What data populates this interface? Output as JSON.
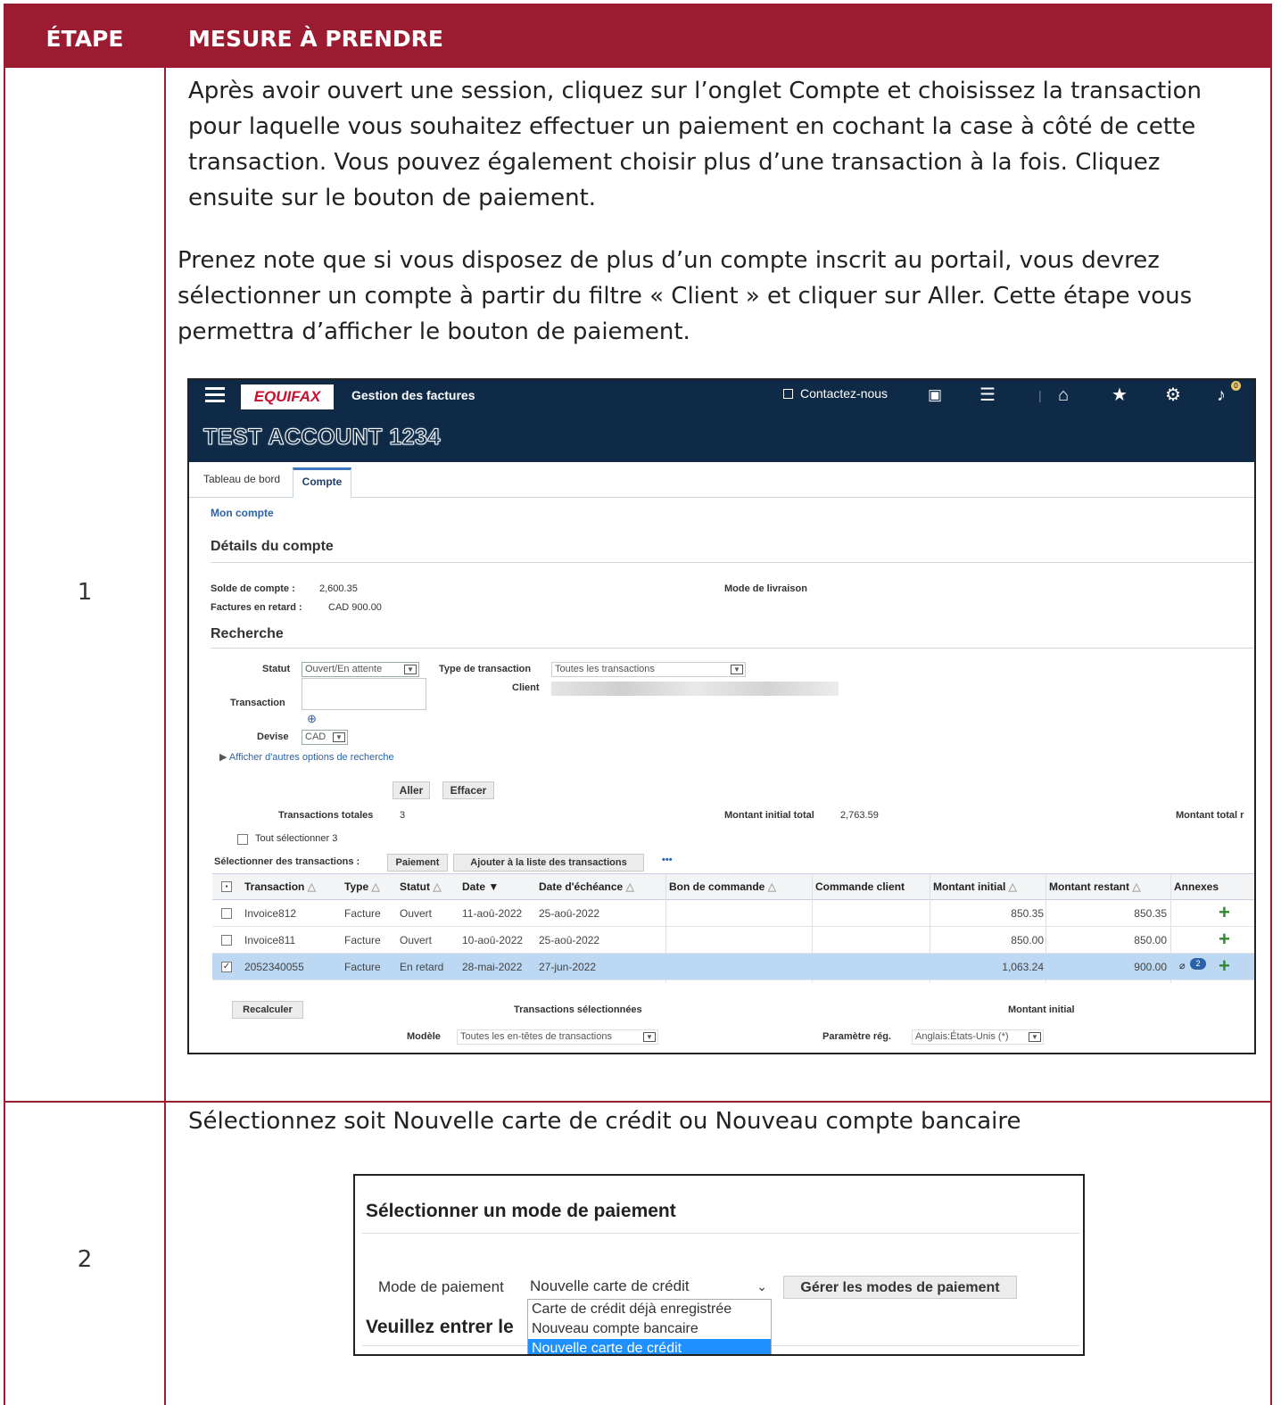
{
  "header": {
    "col_step": "ÉTAPE",
    "col_action": "MESURE À PRENDRE"
  },
  "steps": [
    {
      "number": "1",
      "paragraphs": [
        [
          "Après avoir ouvert une session, cliquez sur l’onglet Compte et choisissez la transaction",
          "pour laquelle vous souhaitez effectuer un paiement en cochant la case à côté de cette",
          "transaction. Vous pouvez également choisir plus d’une transaction à la fois. Cliquez",
          "ensuite sur le bouton de paiement."
        ],
        [
          "Prenez note que si vous disposez de plus d’un compte inscrit au portail, vous devrez",
          "sélectionner un compte à partir du filtre « Client » et cliquer sur Aller. Cette étape vous",
          "permettra d’afficher le bouton de paiement."
        ]
      ]
    },
    {
      "number": "2",
      "paragraphs": [
        [
          "Sélectionnez soit Nouvelle carte de crédit ou Nouveau compte bancaire"
        ]
      ]
    }
  ],
  "screenshot1": {
    "logo": "EQUIFAX",
    "app_title": "Gestion des factures",
    "contact": "Contactez-nous",
    "notification_count": "0",
    "account_name": "TEST ACCOUNT 1234",
    "tabs": [
      "Tableau de bord",
      "Compte"
    ],
    "breadcrumb": "Mon compte",
    "details_title": "Détails du compte",
    "balance_label": "Solde de compte :",
    "balance_value": "2,600.35",
    "overdue_label": "Factures en retard :",
    "overdue_value": "CAD 900.00",
    "delivery_label": "Mode de livraison",
    "search_title": "Recherche",
    "status_label": "Statut",
    "status_value": "Ouvert/En attente",
    "txn_type_label": "Type de transaction",
    "txn_type_value": "Toutes les transactions",
    "client_label": "Client",
    "transaction_label": "Transaction",
    "currency_label": "Devise",
    "currency_value": "CAD",
    "more_options": "Afficher d'autres options de recherche",
    "go_button": "Aller",
    "clear_button": "Effacer",
    "total_txn_label": "Transactions totales",
    "total_txn_value": "3",
    "initial_total_label": "Montant initial total",
    "initial_total_value": "2,763.59",
    "remaining_total_label": "Montant total r",
    "select_all": "Tout sélectionner 3",
    "select_txn_label": "Sélectionner des transactions :",
    "pay_button": "Paiement",
    "add_list_button": "Ajouter à la liste des transactions",
    "more": "•••",
    "columns": [
      "Transaction",
      "Type",
      "Statut",
      "Date",
      "Date d'échéance",
      "Bon de commande",
      "Commande client",
      "Montant initial",
      "Montant restant",
      "Annexes"
    ],
    "rows": [
      {
        "transaction": "Invoice812",
        "type": "Facture",
        "status": "Ouvert",
        "date": "11-aoû-2022",
        "due": "25-aoû-2022",
        "initial": "850.35",
        "remaining": "850.35",
        "checked": false,
        "attachments": ""
      },
      {
        "transaction": "Invoice811",
        "type": "Facture",
        "status": "Ouvert",
        "date": "10-aoû-2022",
        "due": "25-aoû-2022",
        "initial": "850.00",
        "remaining": "850.00",
        "checked": false,
        "attachments": ""
      },
      {
        "transaction": "2052340055",
        "type": "Facture",
        "status": "En retard",
        "date": "28-mai-2022",
        "due": "27-jun-2022",
        "initial": "1,063.24",
        "remaining": "900.00",
        "checked": true,
        "attachments": "2"
      }
    ],
    "recalc_button": "Recalculer",
    "selected_txn_label": "Transactions sélectionnées",
    "initial_amount_label": "Montant initial",
    "model_label": "Modèle",
    "model_value": "Toutes les en-têtes de transactions",
    "locale_label": "Paramètre rég.",
    "locale_value": "Anglais:États-Unis (*)"
  },
  "screenshot2": {
    "title": "Sélectionner un mode de paiement",
    "mode_label": "Mode de paiement",
    "mode_value": "Nouvelle carte de crédit",
    "manage_button": "Gérer les modes de paiement",
    "options": [
      "Carte de crédit déjà enregistrée",
      "Nouveau compte bancaire",
      "Nouvelle carte de crédit"
    ],
    "highlighted_option": "Nouvelle carte de crédit",
    "partial_text": "Veuillez entrer le"
  },
  "colors": {
    "header_bg": "#9b1b30",
    "app_bar": "#0e2a47",
    "selected_row": "#bcd8f2",
    "option_highlight": "#1e90ff"
  }
}
